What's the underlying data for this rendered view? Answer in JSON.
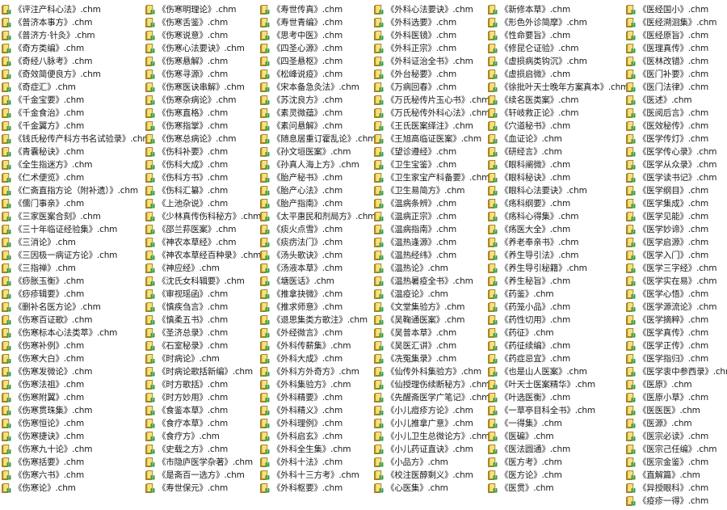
{
  "file_columns": [
    [
      "《评注产科心法》.chm",
      "《普济本事方》.chm",
      "《普济方·针灸》.chm",
      "《奇方类编》.chm",
      "《奇经八脉考》.chm",
      "《奇效简便良方》.chm",
      "《奇症汇》.chm",
      "《千金宝要》.chm",
      "《千金食治》.chm",
      "《千金翼方》.chm",
      "《钱氏秘传产科方书名试验录》.chm",
      "《青囊秘诀》.chm",
      "《全生指迷方》.chm",
      "《仁术便览》.chm",
      "《仁斋直指方论（附补遗）》.chm",
      "《儒门事亲》.chm",
      "《三家医案合刻》.chm",
      "《三十年临证经验集》.chm",
      "《三消论》.chm",
      "《三因极一病证方论》.chm",
      "《三指禅》.chm",
      "《痧胀玉衡》.chm",
      "《痧疹辑要》.chm",
      "《删补名医方论》.chm",
      "《伤寒百证歌》.chm",
      "《伤寒标本心法类萃》.chm",
      "《伤寒补例》.chm",
      "《伤寒大白》.chm",
      "《伤寒发微论》.chm",
      "《伤寒法祖》.chm",
      "《伤寒附翼》.chm",
      "《伤寒贯珠集》.chm",
      "《伤寒恒论》.chm",
      "《伤寒捷诀》.chm",
      "《伤寒九十论》.chm",
      "《伤寒括要》.chm",
      "《伤寒六书》.chm",
      "《伤寒论》.chm"
    ],
    [
      "《伤寒明理论》.chm",
      "《伤寒舌鉴》.chm",
      "《伤寒说意》.chm",
      "《伤寒心法要诀》.chm",
      "《伤寒悬解》.chm",
      "《伤寒寻源》.chm",
      "《伤寒医诀串解》.chm",
      "《伤寒杂病论》.chm",
      "《伤寒直格》.chm",
      "《伤寒指掌》.chm",
      "《伤寒总病论》.chm",
      "《伤科补要》.chm",
      "《伤科大成》.chm",
      "《伤科方书》.chm",
      "《伤科汇纂》.chm",
      "《上池杂说》.chm",
      "《少林真传伤科秘方》.chm",
      "《邵兰荪医案》.chm",
      "《神农本草经》.chm",
      "《神农本草经百种录》.chm",
      "《神应经》.chm",
      "《沈氏女科辑要》.chm",
      "《审视瑶函》.chm",
      "《慎疾刍言》.chm",
      "《慎柔五书》.chm",
      "《圣济总录》.chm",
      "《石室秘录》.chm",
      "《时病论》.chm",
      "《时病论歌括新编》.chm",
      "《时方歌括》.chm",
      "《时方妙用》.chm",
      "《食鉴本草》.chm",
      "《食疗本草》.chm",
      "《食疗方》.chm",
      "《史载之方》.chm",
      "《市隐庐医学杂著》.chm",
      "《是斋百一选方》.chm",
      "《寿世保元》.chm"
    ],
    [
      "《寿世传真》.chm",
      "《寿世青编》.chm",
      "《思考中医》.chm",
      "《四圣心源》.chm",
      "《四圣悬枢》.chm",
      "《松峰说疫》.chm",
      "《宋本备急灸法》.chm",
      "《苏沈良方》.chm",
      "《素灵微蕴》.chm",
      "《素问悬解》.chm",
      "《随息居重订霍乱论》.chm",
      "《孙文垣医案》.chm",
      "《孙真人海上方》.chm",
      "《胎产秘书》.chm",
      "《胎产心法》.chm",
      "《胎产指南》.chm",
      "《太平惠民和剂局方》.chm",
      "《痰火点雪》.chm",
      "《痰疠法门》.chm",
      "《汤头歌诀》.chm",
      "《汤液本草》.chm",
      "《塘医话》.chm",
      "《推拿抉微》.chm",
      "《推求师意》.chm",
      "《退思集类方歌注》.chm",
      "《外经微言》.chm",
      "《外科传薪集》.chm",
      "《外科大成》.chm",
      "《外科方外奇方》.chm",
      "《外科集验方》.chm",
      "《外科精要》.chm",
      "《外科精义》.chm",
      "《外科理例》.chm",
      "《外科启玄》.chm",
      "《外科全生集》.chm",
      "《外科十法》.chm",
      "《外科十三方考》.chm",
      "《外科枢要》.chm"
    ],
    [
      "《外科心法要诀》.chm",
      "《外科选要》.chm",
      "《外科医镜》.chm",
      "《外科正宗》.chm",
      "《外科证治全书》.chm",
      "《外台秘要》.chm",
      "《万病回春》.chm",
      "《万氏秘传片玉心书》.chm",
      "《万氏秘传外科心法》.chm",
      "《王氏医案绎注》.chm",
      "《王旭高临证医案》.chm",
      "《望诊遵经》.chm",
      "《卫生宝鉴》.chm",
      "《卫生家宝产科备要》.chm",
      "《卫生易简方》.chm",
      "《温病条辨》.chm",
      "《温病正宗》.chm",
      "《温病指南》.chm",
      "《温热逢源》.chm",
      "《温热经纬》.chm",
      "《温热论》.chm",
      "《温热暑疫全书》.chm",
      "《温疫论》.chm",
      "《文堂集验方》.chm",
      "《吴鞠通医案》.chm",
      "《吴普本草》.chm",
      "《吴医汇讲》.chm",
      "《冼冤集录》.chm",
      "《仙传外科集验方》.chm",
      "《仙授理伤续断秘方》.chm",
      "《先醒斋医学广笔记》.chm",
      "《小儿痘疹方论》.chm",
      "《小儿推拿广意》.chm",
      "《小儿卫生总微论方》.chm",
      "《小儿药证直诀》.chm",
      "《小品方》.chm",
      "《校注医醇剩义》.chm",
      "《心医集》.chm"
    ],
    [
      "《新修本草》.chm",
      "《形色外诊简摩》.chm",
      "《性命要旨》.chm",
      "《修昆仑证验》.chm",
      "《虚损病类钩沉》.chm",
      "《虚损启微》.chm",
      "《徐批叶天士晚年方案真本》.chm",
      "《续名医类案》.chm",
      "《轩岐救正论》.chm",
      "《穴道秘书》.chm",
      "《血证论》.chm",
      "《研经言》.chm",
      "《眼科阐微》.chm",
      "《眼科秘诀》.chm",
      "《眼科心法要诀》.chm",
      "《疡科纲要》.chm",
      "《疡科心得集》.chm",
      "《疡医大全》.chm",
      "《养老奉亲书》.chm",
      "《养生导引法》.chm",
      "《养生导引秘籍》.chm",
      "《养生秘旨》.chm",
      "《药鉴》.chm",
      "《药笼小品》.chm",
      "《药性切用》.chm",
      "《药征》.chm",
      "《药征续编》.chm",
      "《药症忌宜》.chm",
      "《也是山人医案》.chm",
      "《叶天士医案精华》.chm",
      "《叶选医衡》.chm",
      "《一草亭目科全书》.chm",
      "《一得集》.chm",
      "《医碥》.chm",
      "《医法圆通》.chm",
      "《医方考》.chm",
      "《医方论》.chm",
      "《医贯》.chm"
    ],
    [
      "《医经国小》.chm",
      "《医经溯洄集》.chm",
      "《医经原旨》.chm",
      "《医理真传》.chm",
      "《医林改错》.chm",
      "《医门补要》.chm",
      "《医门法律》.chm",
      "《医述》.chm",
      "《医阅后言》.chm",
      "《医效秘传》.chm",
      "《医学传灯》.chm",
      "《医学传心录》.chm",
      "《医学从众录》.chm",
      "《医学读书记》.chm",
      "《医学纲目》.chm",
      "《医学集成》.chm",
      "《医学见能》.chm",
      "《医学妙谛》.chm",
      "《医学启源》.chm",
      "《医学入门》.chm",
      "《医学三字经》.chm",
      "《医学实在易》.chm",
      "《医学心悟》.chm",
      "《医学源流论》.chm",
      "《医学摘粹》.chm",
      "《医学真传》.chm",
      "《医学正传》.chm",
      "《医学指归》.chm",
      "《医学衷中参西录》.chm",
      "《医原》.chm",
      "《医原小草》.chm",
      "《医医医》.chm",
      "《医源》.chm",
      "《医宗必读》.chm",
      "《医宗己任编》.chm",
      "《医宗金鉴》.chm",
      "《直解篇》.chm",
      "《异授眼科》.chm",
      "《疫疹一得》.chm"
    ]
  ],
  "icon": {
    "name": "chm-file-icon",
    "colors": {
      "yellow": "#f3c12c",
      "green": "#3c9a3c",
      "outline": "#8a6d10"
    }
  }
}
